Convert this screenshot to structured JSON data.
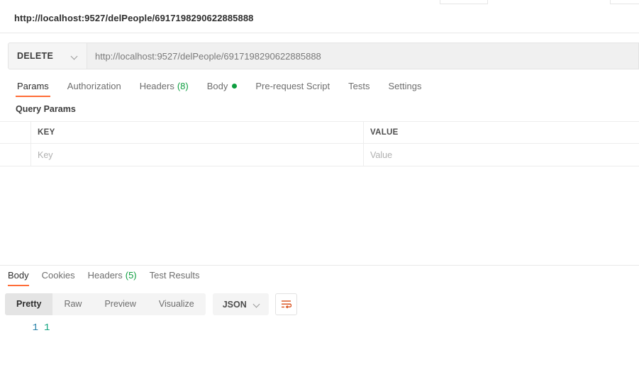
{
  "window": {
    "request_title": "http://localhost:9527/delPeople/6917198290622885888"
  },
  "url_bar": {
    "method": "DELETE",
    "method_chevron_icon": "chevron-down-icon",
    "url": "http://localhost:9527/delPeople/6917198290622885888"
  },
  "request_tabs": [
    {
      "label": "Params",
      "count": "",
      "active": true,
      "dot": false
    },
    {
      "label": "Authorization",
      "count": "",
      "active": false,
      "dot": false
    },
    {
      "label": "Headers",
      "count": "(8)",
      "active": false,
      "dot": false
    },
    {
      "label": "Body",
      "count": "",
      "active": false,
      "dot": true
    },
    {
      "label": "Pre-request Script",
      "count": "",
      "active": false,
      "dot": false
    },
    {
      "label": "Tests",
      "count": "",
      "active": false,
      "dot": false
    },
    {
      "label": "Settings",
      "count": "",
      "active": false,
      "dot": false
    }
  ],
  "query_params": {
    "section_label": "Query Params",
    "columns": [
      "KEY",
      "VALUE"
    ],
    "rows": [
      {
        "key_placeholder": "Key",
        "value_placeholder": "Value"
      }
    ]
  },
  "response_tabs": [
    {
      "label": "Body",
      "count": "",
      "active": true
    },
    {
      "label": "Cookies",
      "count": "",
      "active": false
    },
    {
      "label": "Headers",
      "count": "(5)",
      "active": false
    },
    {
      "label": "Test Results",
      "count": "",
      "active": false
    }
  ],
  "response_toolbar": {
    "views": [
      {
        "label": "Pretty",
        "active": true
      },
      {
        "label": "Raw",
        "active": false
      },
      {
        "label": "Preview",
        "active": false
      },
      {
        "label": "Visualize",
        "active": false
      }
    ],
    "format": "JSON",
    "format_chevron_icon": "chevron-down-icon",
    "wrap_lines_icon": "wrap-lines-icon"
  },
  "response_body": {
    "lines": [
      {
        "number": "1",
        "content": "1"
      }
    ]
  },
  "colors": {
    "accent_orange": "#ff6c37",
    "count_green": "#0d9e3f",
    "body_dot_green": "#0d9e3f",
    "line_number_blue": "#2680a8",
    "json_number_teal": "#10a37f",
    "wrap_icon_orange": "#d94f1a",
    "url_field_gray": "#f0f0f0",
    "method_field_gray": "#f5f5f5"
  }
}
